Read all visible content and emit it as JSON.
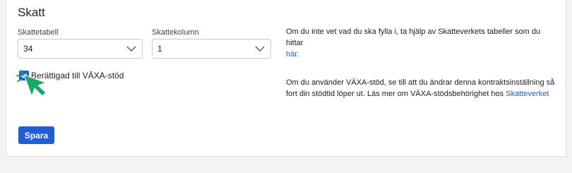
{
  "section": {
    "title": "Skatt"
  },
  "fields": {
    "skattetabell": {
      "label": "Skattetabell",
      "value": "34"
    },
    "skattekolumn": {
      "label": "Skattekolumn",
      "value": "1"
    }
  },
  "info1": {
    "text": "Om du inte vet vad du ska fylla i, ta hjälp av Skatteverkets tabeller som du hittar",
    "link": "här."
  },
  "vaxa": {
    "checkbox_label": "Berättigad till VÄXA-stöd",
    "checked": true,
    "info_text": "Om du använder VÄXA-stöd, se till att du ändrar denna kontraktsinställning så fort din stödtid löper ut. Läs mer om VÄXA-stödsbehörighet hos",
    "info_link": "Skatteverket"
  },
  "actions": {
    "save_label": "Spara"
  },
  "colors": {
    "accent": "#1f5fd6",
    "cursor": "#1aa86b"
  }
}
